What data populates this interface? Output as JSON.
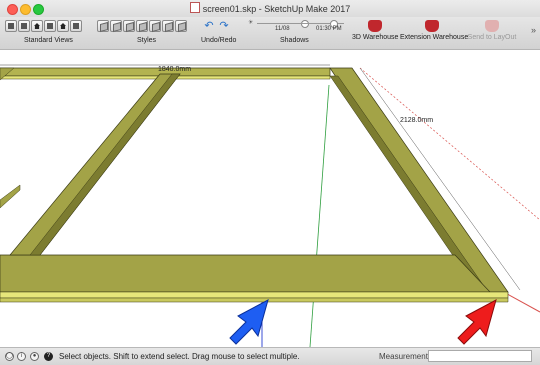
{
  "window": {
    "title": "screen01.skp - SketchUp Make 2017"
  },
  "toolbar": {
    "groups": {
      "standard_views": "Standard Views",
      "styles": "Styles",
      "undo_redo": "Undo/Redo",
      "shadows": "Shadows"
    },
    "shadows": {
      "date": "11/08",
      "time": "01:30 PM",
      "date_level": 0.55,
      "time_level": 0.5
    },
    "buttons": {
      "warehouse": "3D Warehouse",
      "extension": "Extension Warehouse",
      "layout": "Send to LayOut"
    },
    "overflow": "»"
  },
  "viewport": {
    "dim_top": "1840.0mm",
    "dim_right": "2128.0mm",
    "colors": {
      "wood": "#a3a347",
      "wood_dark": "#7c7c30",
      "wood_light": "#e6e67a",
      "axis_red": "#d9534f",
      "axis_green": "#2e9e3e",
      "axis_blue": "#3b4fd4",
      "arrow_blue": "#1e5ef2",
      "arrow_red": "#ee1c1c"
    }
  },
  "status": {
    "text": "Select objects. Shift to extend select. Drag mouse to select multiple.",
    "measurements_label": "Measurements",
    "measurements_value": ""
  }
}
